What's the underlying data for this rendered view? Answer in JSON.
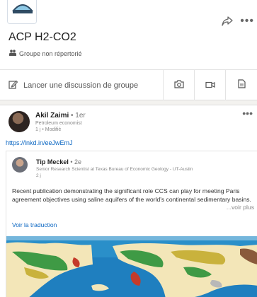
{
  "group": {
    "title": "ACP H2-CO2",
    "subtitle": "Groupe non répertorié",
    "share_icon": "share-arrow-icon",
    "more_icon": "more-dots-icon"
  },
  "actions": {
    "start_discussion": "Lancer une discussion de groupe",
    "photo_icon": "camera-icon",
    "video_icon": "video-icon",
    "document_icon": "document-icon"
  },
  "post": {
    "author": "Akil Zaimi",
    "degree": "• 1er",
    "headline": "Petroleum economist",
    "time": "1 j • Modifié",
    "link": "https://lnkd.in/eeJwEmJ",
    "shared": {
      "author": "Tip Meckel",
      "degree": "• 2e",
      "headline": "Senior Research Scientist at Texas Bureau of Economic Geology - UT-Austin",
      "time": "2 j",
      "text": "Recent publication demonstrating the significant role CCS can play for meeting Paris agreement objectives using saline aquifers of the world's continental sedimentary basins.",
      "see_more": "...voir plus",
      "translate": "Voir la traduction"
    }
  }
}
